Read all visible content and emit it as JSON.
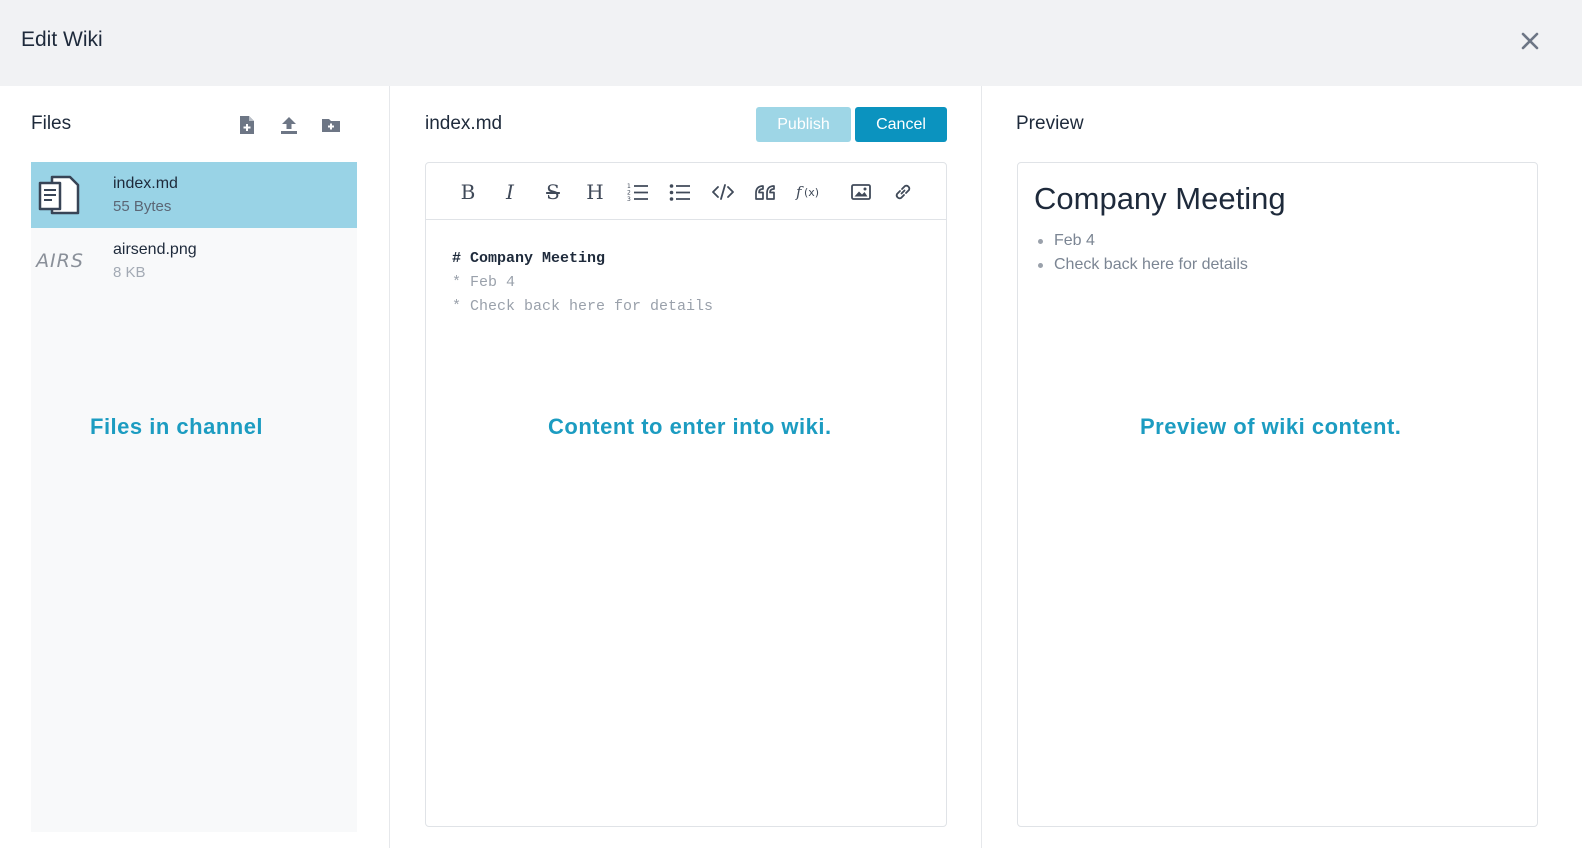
{
  "header": {
    "title": "Edit Wiki",
    "close_icon": "close-icon"
  },
  "files_panel": {
    "title": "Files",
    "actions": [
      {
        "icon": "new-file-icon"
      },
      {
        "icon": "upload-icon"
      },
      {
        "icon": "new-folder-icon"
      }
    ],
    "items": [
      {
        "name": "index.md",
        "size": "55 Bytes",
        "icon": "document-icon",
        "selected": true
      },
      {
        "name": "airsend.png",
        "size": "8 KB",
        "thumb_text": "AIRS",
        "selected": false
      }
    ],
    "annotation": "Files in channel"
  },
  "editor_panel": {
    "filename": "index.md",
    "publish_label": "Publish",
    "cancel_label": "Cancel",
    "toolbar": [
      {
        "name": "bold",
        "glyph": "B"
      },
      {
        "name": "italic",
        "glyph": "I"
      },
      {
        "name": "strikethrough",
        "glyph": "S"
      },
      {
        "name": "heading",
        "glyph": "H"
      },
      {
        "name": "ordered-list"
      },
      {
        "name": "unordered-list"
      },
      {
        "name": "code"
      },
      {
        "name": "quote"
      },
      {
        "name": "formula"
      },
      {
        "name": "image"
      },
      {
        "name": "link"
      }
    ],
    "content_lines": [
      "# Company Meeting",
      "* Feb 4",
      "* Check back here for details"
    ],
    "annotation": "Content to enter into wiki."
  },
  "preview_panel": {
    "title": "Preview",
    "heading": "Company Meeting",
    "items": [
      "Feb 4",
      "Check back here for details"
    ],
    "annotation": "Preview of wiki content."
  },
  "colors": {
    "accent": "#0b93bf",
    "accent_light": "#9ed6e6",
    "selected_row": "#99d3e6",
    "annotation": "#1c9cc1",
    "header_bg": "#f1f2f4"
  }
}
